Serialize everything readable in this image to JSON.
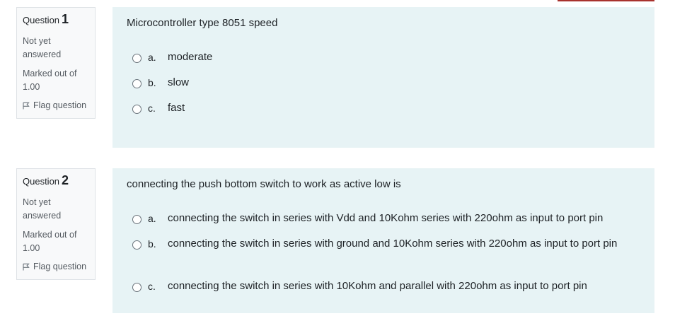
{
  "questions": [
    {
      "label": "Question",
      "number": "1",
      "state": "Not yet answered",
      "grade": "Marked out of 1.00",
      "flag_label": "Flag question",
      "text": "Microcontroller type 8051 speed",
      "answers": [
        {
          "letter": "a.",
          "text": "moderate"
        },
        {
          "letter": "b.",
          "text": "slow"
        },
        {
          "letter": "c.",
          "text": "fast"
        }
      ]
    },
    {
      "label": "Question",
      "number": "2",
      "state": "Not yet answered",
      "grade": "Marked out of 1.00",
      "flag_label": "Flag question",
      "text": "connecting the push bottom switch to work as active low is",
      "answers": [
        {
          "letter": "a.",
          "text": "connecting the switch in series with Vdd and 10Kohm series with 220ohm as input to port pin"
        },
        {
          "letter": "b.",
          "text": "connecting the switch in series with ground and 10Kohm series with 220ohm as input to port pin"
        },
        {
          "letter": "c.",
          "text": "connecting the switch in series with 10Kohm and parallel with 220ohm as input to port pin"
        }
      ]
    }
  ],
  "colors": {
    "content_bg": "#e7f3f5",
    "info_bg": "#f8f9fa",
    "accent": "#a8322d"
  },
  "icons": {
    "flag": "flag-icon"
  }
}
